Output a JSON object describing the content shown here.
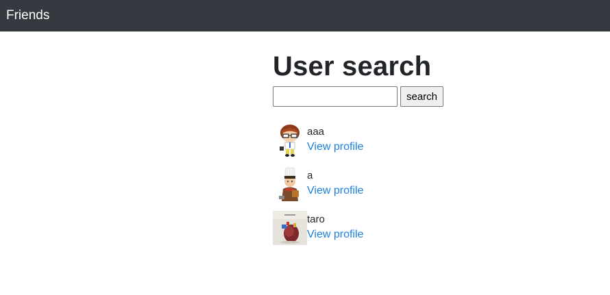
{
  "navbar": {
    "brand": "Friends"
  },
  "page": {
    "title": "User search"
  },
  "search": {
    "placeholder": "",
    "value": "",
    "button_label": "search"
  },
  "users": [
    {
      "name": "aaa",
      "link_label": "View profile",
      "avatar": "cartoon-boy-glasses-avatar"
    },
    {
      "name": "a",
      "link_label": "View profile",
      "avatar": "chef-avatar"
    },
    {
      "name": "taro",
      "link_label": "View profile",
      "avatar": "photo-avatar"
    }
  ]
}
